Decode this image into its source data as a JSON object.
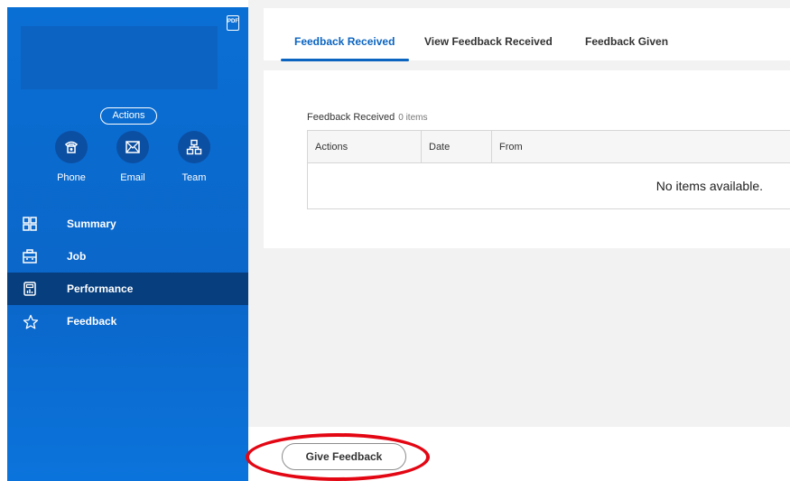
{
  "sidebar": {
    "actions_label": "Actions",
    "contacts": [
      {
        "label": "Phone",
        "icon": "phone-icon"
      },
      {
        "label": "Email",
        "icon": "email-icon"
      },
      {
        "label": "Team",
        "icon": "team-icon"
      }
    ],
    "nav": [
      {
        "label": "Summary",
        "icon": "summary-icon",
        "active": false
      },
      {
        "label": "Job",
        "icon": "job-icon",
        "active": false
      },
      {
        "label": "Performance",
        "icon": "performance-icon",
        "active": true
      },
      {
        "label": "Feedback",
        "icon": "star-icon",
        "active": false
      }
    ]
  },
  "tabs": [
    {
      "label": "Feedback Received",
      "active": true
    },
    {
      "label": "View Feedback Received",
      "active": false
    },
    {
      "label": "Feedback Given",
      "active": false
    }
  ],
  "grid": {
    "title": "Feedback Received",
    "count": "0 items",
    "columns": [
      "Actions",
      "Date",
      "From"
    ],
    "empty_message": "No items available."
  },
  "give_feedback_label": "Give Feedback",
  "colors": {
    "sidebar_blue": "#0b6bcf",
    "active_nav": "#063e7e",
    "tab_accent": "#0b64c0",
    "annotation_red": "#e30613"
  }
}
